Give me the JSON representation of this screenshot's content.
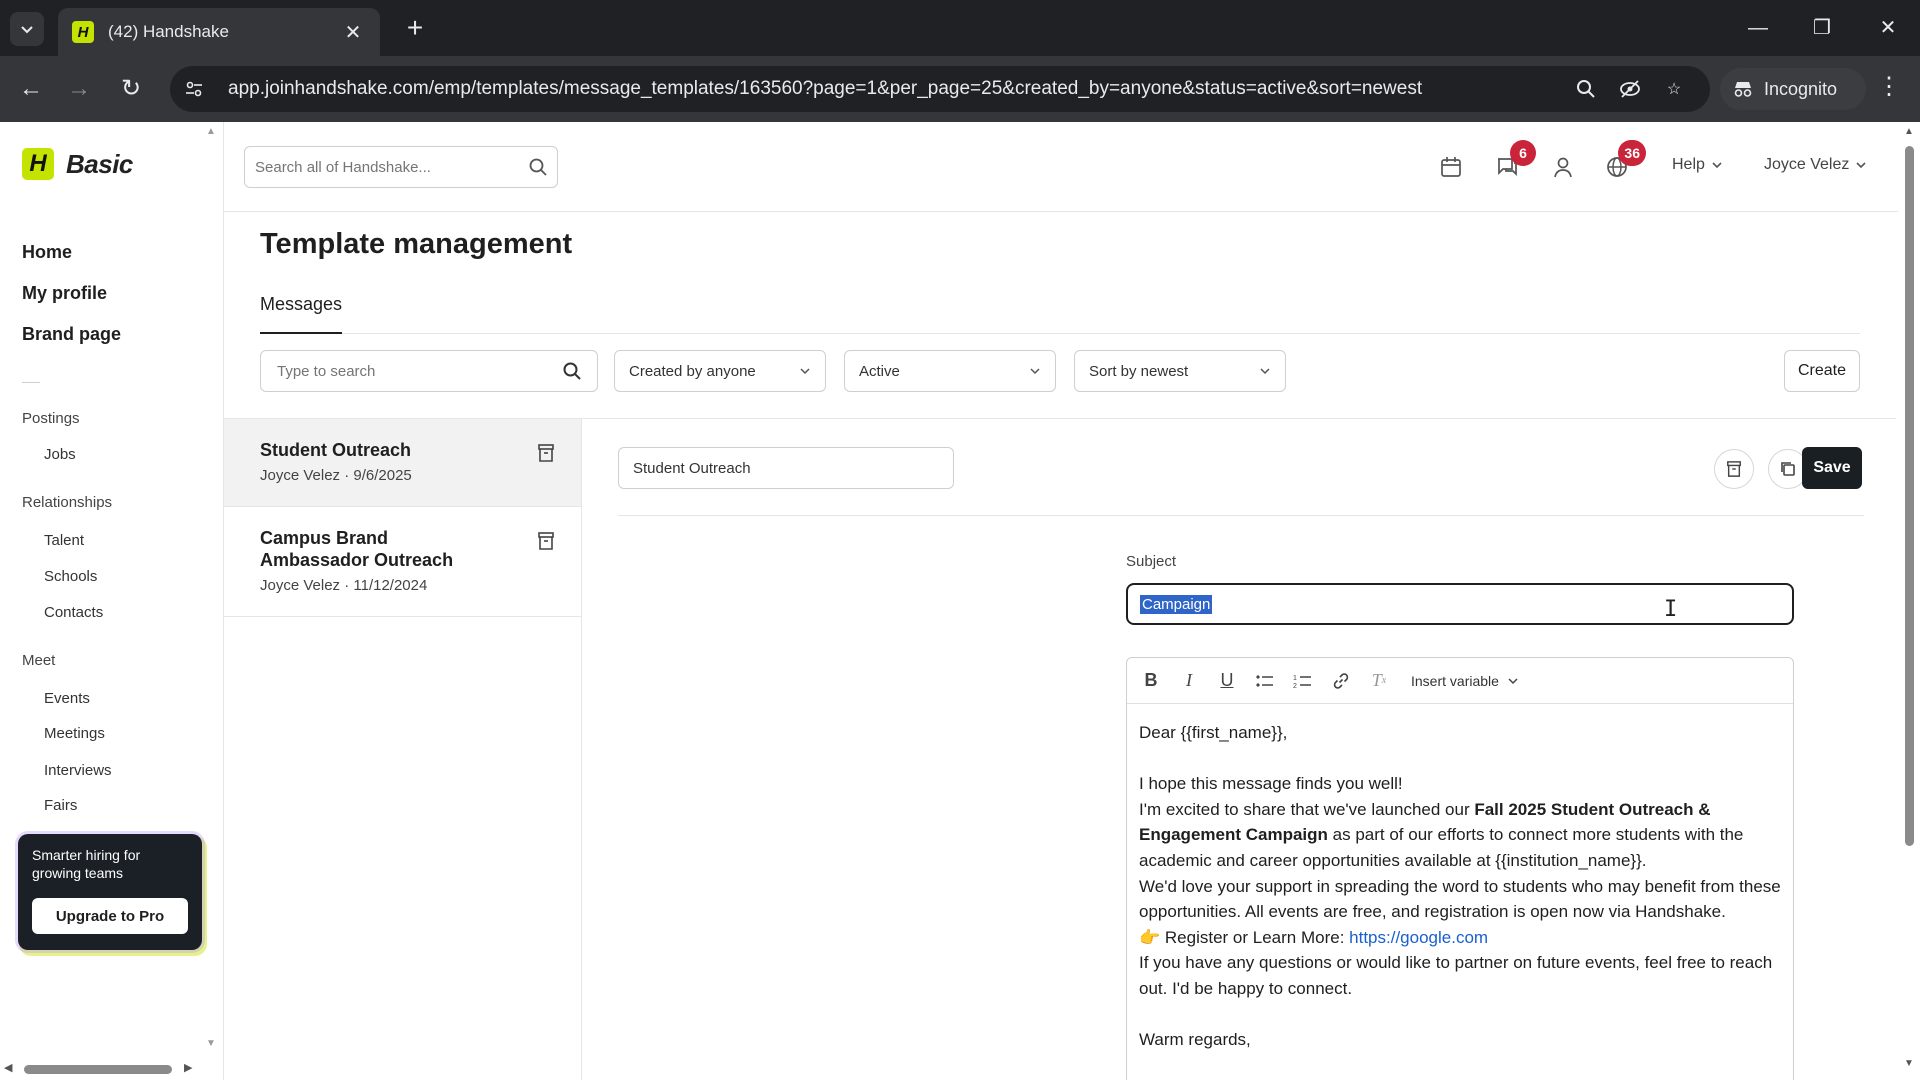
{
  "browser": {
    "tab_title": "(42) Handshake",
    "favicon_letter": "H",
    "url": "app.joinhandshake.com/emp/templates/message_templates/163560?page=1&per_page=25&created_by=anyone&status=active&sort=newest",
    "incognito_label": "Incognito"
  },
  "sidebar": {
    "logo_letter": "H",
    "brand": "Basic",
    "main_nav": [
      {
        "label": "Home"
      },
      {
        "label": "My profile"
      },
      {
        "label": "Brand page"
      }
    ],
    "sections": [
      {
        "title": "Postings",
        "items": [
          "Jobs"
        ]
      },
      {
        "title": "Relationships",
        "items": [
          "Talent",
          "Schools",
          "Contacts"
        ]
      },
      {
        "title": "Meet",
        "items": [
          "Events",
          "Meetings",
          "Interviews",
          "Fairs"
        ]
      }
    ],
    "promo": {
      "text": "Smarter hiring for growing teams",
      "button": "Upgrade to Pro"
    }
  },
  "header": {
    "search_placeholder": "Search all of Handshake...",
    "messages_badge": "6",
    "notifications_badge": "36",
    "help_label": "Help",
    "user_name": "Joyce Velez"
  },
  "page": {
    "title": "Template management",
    "tab": "Messages"
  },
  "filters": {
    "search_placeholder": "Type to search",
    "created_by": "Created by anyone",
    "status": "Active",
    "sort": "Sort by newest",
    "create_label": "Create"
  },
  "templates": [
    {
      "title": "Student Outreach",
      "meta": "Joyce Velez · 9/6/2025",
      "selected": true
    },
    {
      "title": "Campus Brand Ambassador Outreach",
      "meta": "Joyce Velez · 11/12/2024",
      "selected": false
    }
  ],
  "editor": {
    "template_name": "Student Outreach",
    "save_label": "Save",
    "subject_label": "Subject",
    "subject_value": "Campaign",
    "insert_variable_label": "Insert variable",
    "body": {
      "greeting": "Dear {{first_name}},",
      "p1": "I hope this message finds you well!",
      "p2_pre": "I'm excited to share that we've launched our ",
      "p2_bold": "Fall 2025 Student Outreach & Engagement Campaign",
      "p2_post": " as part of our efforts to connect more students with the academic and career opportunities available at {{institution_name}}.",
      "p3": "We'd love your support in spreading the word to students who may benefit from these opportunities. All events are free, and registration is open now via Handshake.",
      "p4_emoji": "👉",
      "p4_text": "Register or Learn More: ",
      "p4_link": "https://google.com",
      "p5": "If you have any questions or would like to partner on future events, feel free to reach out. I'd be happy to connect.",
      "closing": "Warm regards,"
    }
  }
}
